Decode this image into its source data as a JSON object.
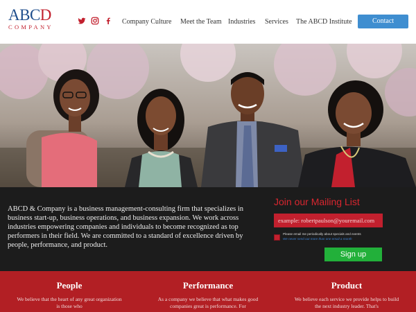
{
  "header": {
    "logo": {
      "main_blue": "ABC",
      "main_red": "D",
      "sub": "COMPANY"
    },
    "social": [
      "twitter-icon",
      "instagram-icon",
      "facebook-icon"
    ],
    "nav": [
      "Company Culture",
      "Meet the Team",
      "Industries",
      "Services",
      "The ABCD Institute"
    ],
    "contact_label": "Contact"
  },
  "about": {
    "text": "ABCD & Company is a business management-consulting firm that specializes in business start-up, business operations, and business expansion. We work across industries empowering companies and individuals to become recognized as top performers in their field. We are committed to a standard of excellence driven by people, performance, and product."
  },
  "mailing": {
    "title": "Join our Mailing List",
    "email_value": "",
    "email_placeholder": "example: robertpaulson@youremail.com",
    "optin_label": "Please email me periodically about specials and events",
    "optin_note": "We never send out more than one email a month",
    "signup_label": "Sign up"
  },
  "pillars": [
    {
      "title": "People",
      "text": "We believe that the heart of any great organization is those who"
    },
    {
      "title": "Performance",
      "text": "As a company we believe that what makes good companies great is performance. For"
    },
    {
      "title": "Product",
      "text": "We believe each service we provide helps to build the next industry leader. That's"
    }
  ],
  "colors": {
    "brand_blue": "#1f4e8c",
    "brand_red": "#c2202e",
    "contact_blue": "#3f8ed0",
    "dark_band": "#1c1c1c",
    "red_band": "#b21f24",
    "signup_green": "#22b03a"
  }
}
